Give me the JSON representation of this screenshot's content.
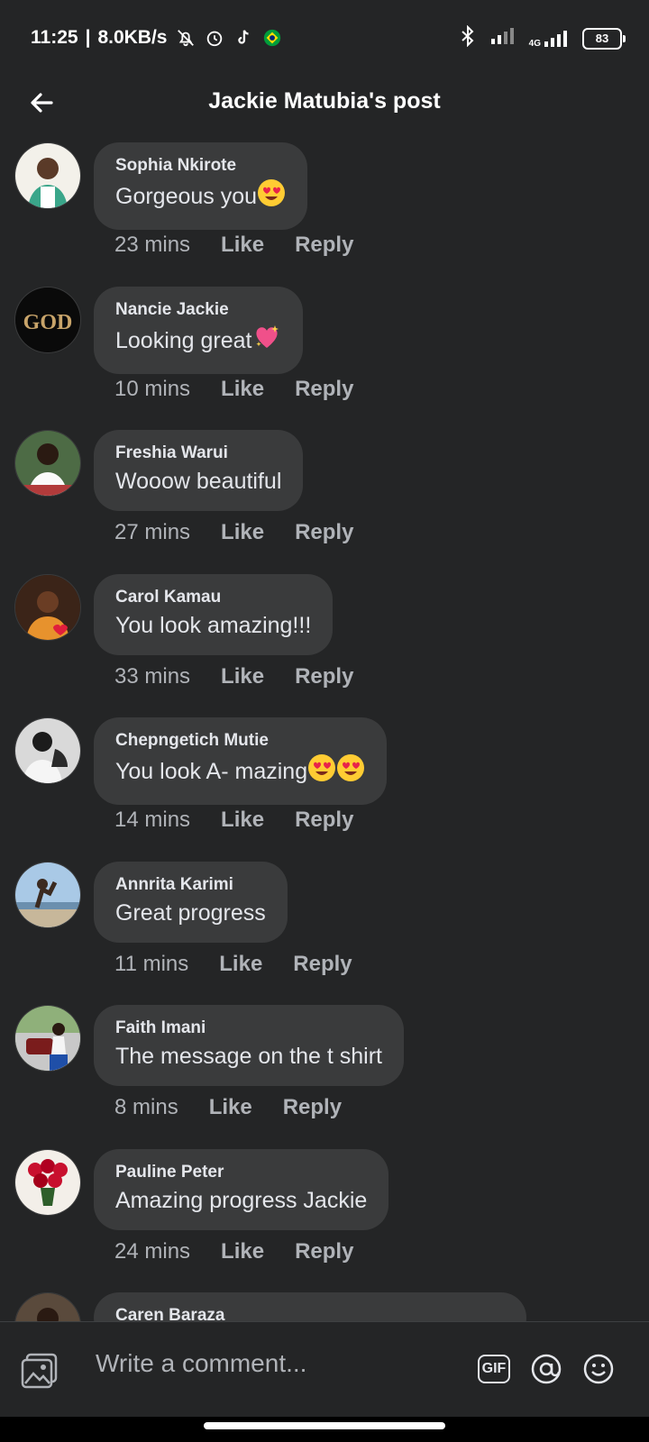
{
  "status_bar": {
    "time": "11:25",
    "speed": "8.0KB/s",
    "network": "4G",
    "battery": "83",
    "icons": [
      "mute-icon",
      "alarm-icon",
      "tiktok-icon",
      "brazil-flag-icon",
      "bluetooth-icon",
      "signal-icon",
      "signal-4g-icon",
      "battery-icon"
    ]
  },
  "header": {
    "title": "Jackie Matubia's post",
    "back_icon": "back-arrow-icon"
  },
  "actions": {
    "like": "Like",
    "reply": "Reply"
  },
  "comments": [
    {
      "name": "Sophia Nkirote",
      "text": "Gorgeous you",
      "emoji": "heart-eyes",
      "time": "23 mins"
    },
    {
      "name": "Nancie Jackie",
      "text": "Looking great",
      "emoji": "sparkling-heart",
      "time": "10 mins"
    },
    {
      "name": "Freshia Warui",
      "text": "Wooow beautiful",
      "emoji": "",
      "time": "27 mins"
    },
    {
      "name": "Carol Kamau",
      "text": "You look amazing!!!",
      "emoji": "",
      "time": "33 mins"
    },
    {
      "name": "Chepngetich Mutie",
      "text": "You look A- mazing",
      "emoji": "heart-eyes-x2",
      "time": "14 mins"
    },
    {
      "name": "Annrita Karimi",
      "text": "Great progress",
      "emoji": "",
      "time": "11 mins"
    },
    {
      "name": "Faith Imani",
      "text": "The message on the t shirt",
      "emoji": "",
      "time": "8 mins"
    },
    {
      "name": "Pauline Peter",
      "text": "Amazing progress Jackie",
      "emoji": "",
      "time": "24 mins"
    },
    {
      "name": "Caren Baraza",
      "text": "",
      "emoji": "",
      "time": ""
    }
  ],
  "compose": {
    "placeholder": "Write a comment...",
    "gif_label": "GIF",
    "icons": [
      "photo-icon",
      "gif-icon",
      "mention-icon",
      "emoji-icon"
    ]
  },
  "colors": {
    "background": "#242526",
    "bubble": "#3a3b3c",
    "text": "#e4e6eb",
    "secondary": "#b0b3b8"
  }
}
